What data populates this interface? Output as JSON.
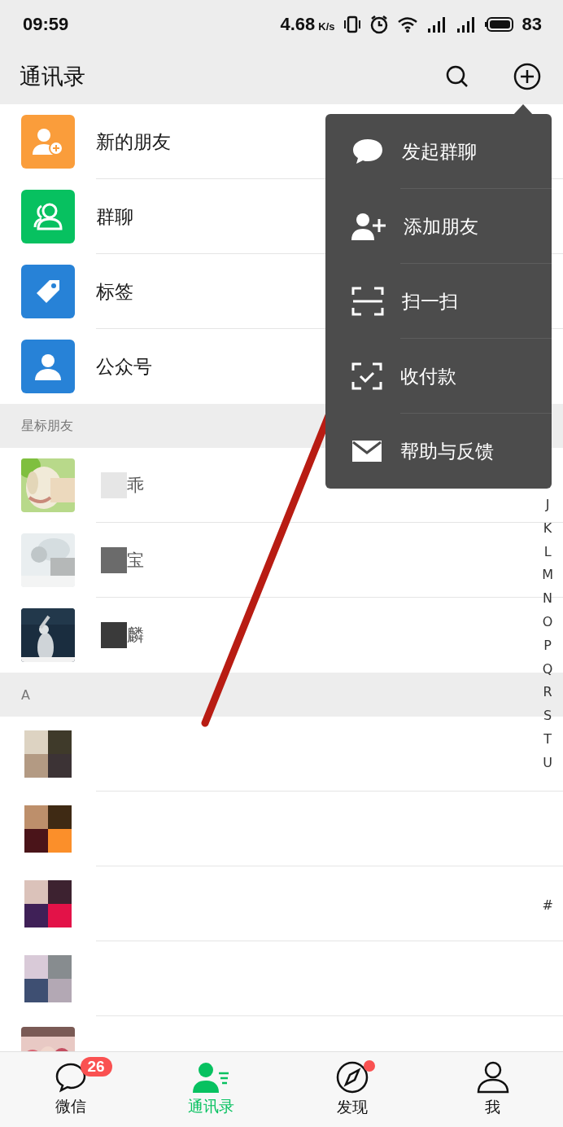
{
  "status_bar": {
    "time": "09:59",
    "speed": "4.68",
    "speed_unit": "K/s",
    "battery": "83"
  },
  "header": {
    "title": "通讯录"
  },
  "entries": [
    {
      "kind": "new-friends",
      "label": "新的朋友"
    },
    {
      "kind": "group-chat",
      "label": "群聊"
    },
    {
      "kind": "tags",
      "label": "标签"
    },
    {
      "kind": "official",
      "label": "公众号"
    }
  ],
  "sections": [
    {
      "title": "星标朋友",
      "contacts": [
        {
          "name": "乖",
          "redacted": true
        },
        {
          "name": "宝",
          "redacted": true
        },
        {
          "name": "麟",
          "redacted": true
        }
      ]
    },
    {
      "title": "A",
      "contacts": [
        {
          "redacted": false
        },
        {
          "redacted": false
        },
        {
          "redacted": false
        },
        {
          "redacted": false
        },
        {
          "redacted": false
        }
      ]
    }
  ],
  "index": [
    "J",
    "K",
    "L",
    "M",
    "N",
    "O",
    "P",
    "Q",
    "R",
    "S",
    "T",
    "U",
    "#"
  ],
  "popup_menu": [
    {
      "kind": "chat",
      "label": "发起群聊"
    },
    {
      "kind": "add-friend",
      "label": "添加朋友"
    },
    {
      "kind": "scan",
      "label": "扫一扫"
    },
    {
      "kind": "pay",
      "label": "收付款"
    },
    {
      "kind": "help",
      "label": "帮助与反馈"
    }
  ],
  "tab_bar": [
    {
      "kind": "chats",
      "label": "微信",
      "selected": false,
      "badge": "26"
    },
    {
      "kind": "contacts",
      "label": "通讯录",
      "selected": true
    },
    {
      "kind": "discover",
      "label": "发现",
      "selected": false,
      "dot": true
    },
    {
      "kind": "me",
      "label": "我",
      "selected": false
    }
  ]
}
